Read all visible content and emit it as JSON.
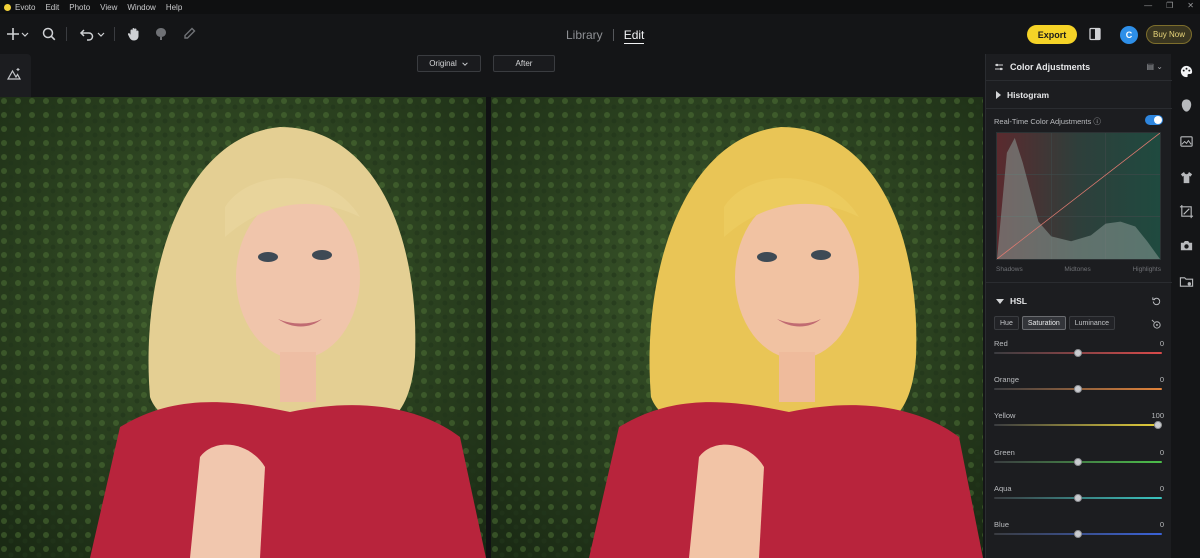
{
  "menubar": {
    "app_name": "Evoto",
    "items": [
      "Edit",
      "Photo",
      "View",
      "Window",
      "Help"
    ]
  },
  "toolbar": {
    "nav_library": "Library",
    "nav_edit": "Edit",
    "export_label": "Export",
    "avatar_initial": "C",
    "buy_now_label": "Buy Now",
    "accent_color": "#f5d327"
  },
  "view_toggle": {
    "original_label": "Original",
    "after_label": "After"
  },
  "panel": {
    "title": "Color Adjustments",
    "histogram_title": "Histogram",
    "realtime_label": "Real-Time Color Adjustments",
    "realtime_enabled": true,
    "histogram_labels": [
      "Shadows",
      "Midtones",
      "Highlights"
    ],
    "hsl_title": "HSL",
    "hsl_tabs": [
      {
        "label": "Hue",
        "active": false
      },
      {
        "label": "Saturation",
        "active": true
      },
      {
        "label": "Luminance",
        "active": false
      }
    ],
    "sliders": [
      {
        "label": "Red",
        "value": 0,
        "display": "0",
        "color": "#d94a4a"
      },
      {
        "label": "Orange",
        "value": 0,
        "display": "0",
        "color": "#e3843a"
      },
      {
        "label": "Yellow",
        "value": 100,
        "display": "100",
        "color": "#e8d23a"
      },
      {
        "label": "Green",
        "value": 0,
        "display": "0",
        "color": "#4cbf4a"
      },
      {
        "label": "Aqua",
        "value": 0,
        "display": "0",
        "color": "#3ac4c0"
      },
      {
        "label": "Blue",
        "value": 0,
        "display": "0",
        "color": "#3a62d8"
      }
    ]
  }
}
